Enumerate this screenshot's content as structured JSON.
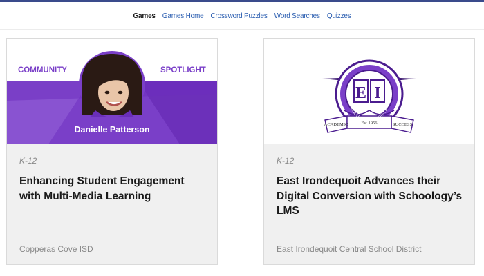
{
  "nav": {
    "items": [
      {
        "label": "Games",
        "active": true
      },
      {
        "label": "Games Home",
        "active": false
      },
      {
        "label": "Crossword Puzzles",
        "active": false
      },
      {
        "label": "Word Searches",
        "active": false
      },
      {
        "label": "Quizzes",
        "active": false
      }
    ]
  },
  "cards": [
    {
      "hero": {
        "left_text": "COMMUNITY",
        "right_text": "SPOTLIGHT",
        "name": "Danielle Patterson"
      },
      "tag": "K-12",
      "title": "Enhancing Student Engagement with Multi-Media Learning",
      "source": "Copperas Cove ISD"
    },
    {
      "logo": {
        "arc_text": "EAST IRONDEQUOIT",
        "letters_left": "E",
        "letters_right": "I",
        "ring_text": "CENTRAL SCHOOL DISTRICT",
        "ribbon_left": "ACADEMIC",
        "ribbon_mid": "Est.1956",
        "ribbon_right": "SUCCESS"
      },
      "tag": "K-12",
      "title": "East Irondequoit Advances their Digital Conversion with Schoology’s LMS",
      "source": "East Irondequoit Central School District"
    }
  ],
  "colors": {
    "purple": "#7a3fc8",
    "purple_dark": "#4b1c8f",
    "text_dark": "#1a1a1a",
    "text_muted": "#8a8a8a",
    "link": "#2a5db0"
  }
}
